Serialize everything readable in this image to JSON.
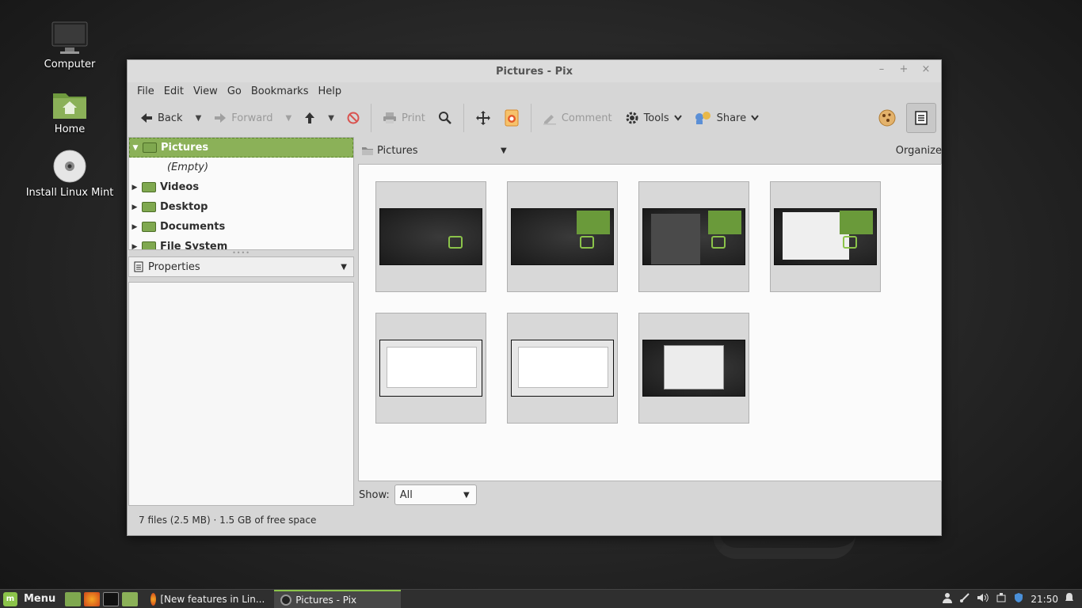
{
  "desktop": {
    "icons": [
      {
        "label": "Computer",
        "icon": "computer-icon"
      },
      {
        "label": "Home",
        "icon": "home-folder-icon"
      },
      {
        "label": "Install Linux Mint",
        "icon": "disc-icon"
      }
    ]
  },
  "window": {
    "title": "Pictures - Pix",
    "controls": {
      "minimize": "–",
      "maximize": "+",
      "close": "×"
    },
    "menu": [
      "File",
      "Edit",
      "View",
      "Go",
      "Bookmarks",
      "Help"
    ],
    "toolbar": {
      "back": "Back",
      "forward": "Forward",
      "print": "Print",
      "comment": "Comment",
      "tools": "Tools",
      "share": "Share"
    },
    "sidebar": {
      "tree": [
        {
          "label": "Pictures",
          "selected": true,
          "expanded": true
        },
        {
          "label": "Videos"
        },
        {
          "label": "Desktop"
        },
        {
          "label": "Documents"
        },
        {
          "label": "File System"
        }
      ],
      "empty_label": "(Empty)",
      "properties_label": "Properties"
    },
    "location": {
      "label": "Pictures",
      "organize": "Organize"
    },
    "thumbnails": [
      {
        "kind": "desktop-plain"
      },
      {
        "kind": "desktop-widget"
      },
      {
        "kind": "desktop-menu"
      },
      {
        "kind": "desktop-dialog"
      },
      {
        "kind": "settings-window"
      },
      {
        "kind": "settings-window"
      },
      {
        "kind": "desktop-dialog-gray"
      }
    ],
    "filter": {
      "label": "Show:",
      "value": "All"
    },
    "status": "7 files (2.5 MB) · 1.5 GB of free space"
  },
  "taskbar": {
    "menu_label": "Menu",
    "tasks": [
      {
        "label": "[New features in Lin...",
        "active": false
      },
      {
        "label": "Pictures - Pix",
        "active": true
      }
    ],
    "clock": "21:50"
  },
  "colors": {
    "accent": "#8bb158",
    "panel": "#2f2f2f"
  }
}
